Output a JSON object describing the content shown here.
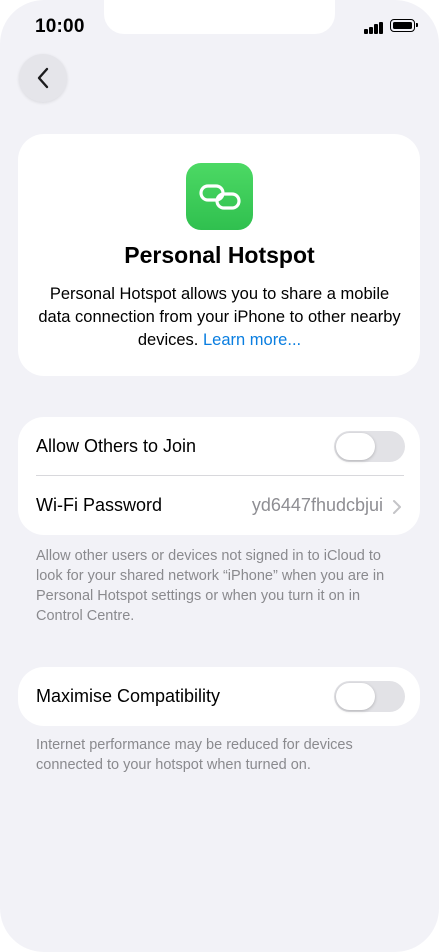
{
  "status_bar": {
    "time": "10:00"
  },
  "navigation": {
    "back_icon": "chevron-left-icon"
  },
  "hero": {
    "icon": "link-icon",
    "icon_color": "#34c759",
    "title": "Personal Hotspot",
    "description": "Personal Hotspot allows you to share a mobile data connection from your iPhone to other nearby devices.",
    "learn_more": "Learn more..."
  },
  "network_group": {
    "allow_others_label": "Allow Others to Join",
    "allow_others_on": false,
    "wifi_password_label": "Wi-Fi Password",
    "wifi_password_value": "yd6447fhudcbjui",
    "footnote": "Allow other users or devices not signed in to iCloud to look for your shared network “iPhone” when you are in Personal Hotspot settings or when you turn it on in Control Centre."
  },
  "compatibility_group": {
    "maximise_label": "Maximise Compatibility",
    "maximise_on": false,
    "footnote": "Internet performance may be reduced for devices connected to your hotspot when turned on."
  },
  "colors": {
    "background": "#f2f2f7",
    "link": "#0a7ee0",
    "secondary_text": "#8a8a8e"
  }
}
